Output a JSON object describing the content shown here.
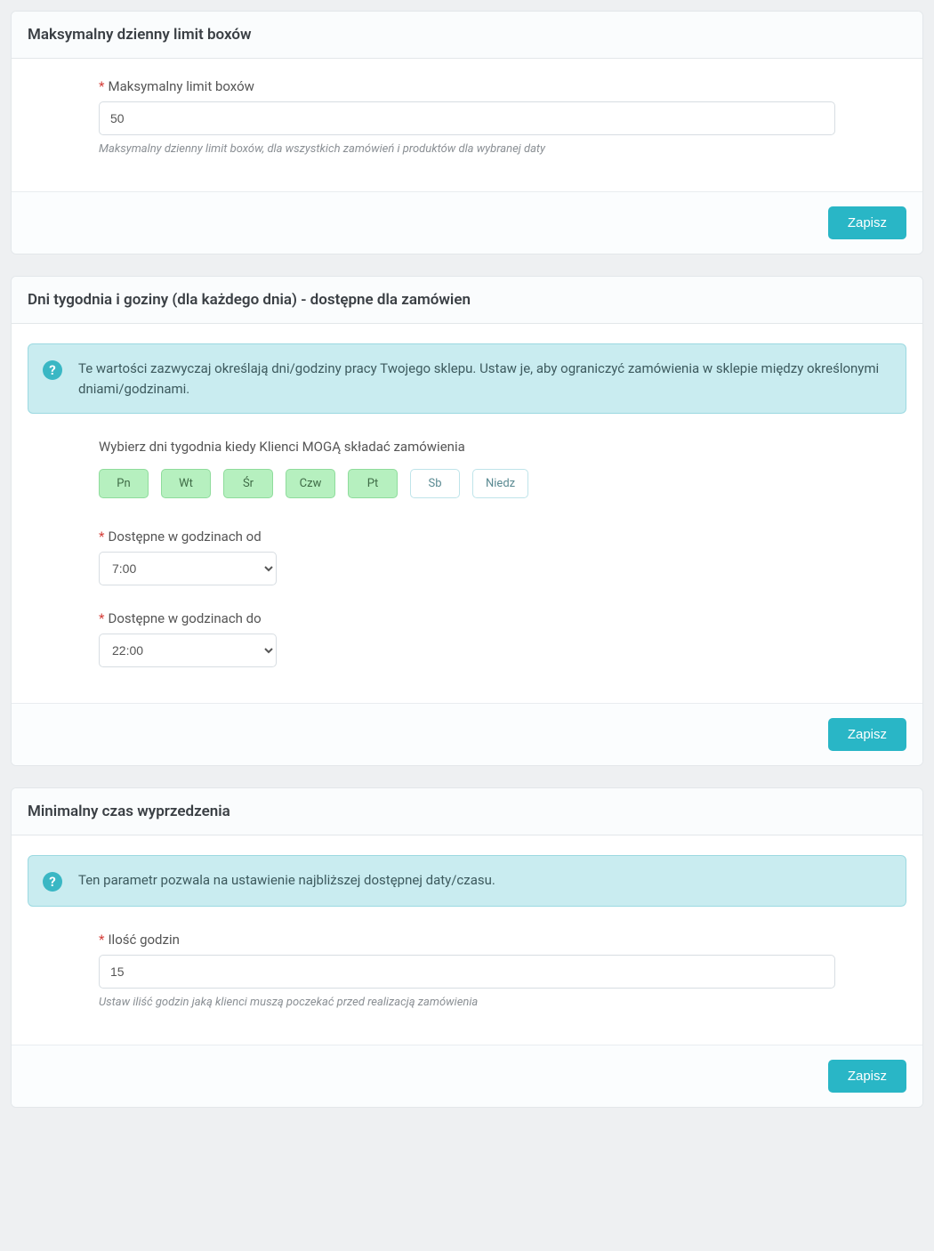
{
  "common": {
    "save_label": "Zapisz"
  },
  "panel1": {
    "title": "Maksymalny dzienny limit boxów",
    "field_label": "Maksymalny limit boxów",
    "field_value": "50",
    "help": "Maksymalny dzienny limit boxów, dla wszystkich zamówień i produktów dla wybranej daty"
  },
  "panel2": {
    "title": "Dni tygodnia i goziny (dla każdego dnia) - dostępne dla zamówien",
    "info": "Te wartości zazwyczaj określają dni/godziny pracy Twojego sklepu. Ustaw je, aby ograniczyć zamówienia w sklepie między określonymi dniami/godzinami.",
    "days_label": "Wybierz dni tygodnia kiedy Klienci MOGĄ składać zamówienia",
    "days": [
      {
        "label": "Pn",
        "selected": true
      },
      {
        "label": "Wt",
        "selected": true
      },
      {
        "label": "Śr",
        "selected": true
      },
      {
        "label": "Czw",
        "selected": true
      },
      {
        "label": "Pt",
        "selected": true
      },
      {
        "label": "Sb",
        "selected": false
      },
      {
        "label": "Niedz",
        "selected": false
      }
    ],
    "from_label": "Dostępne w godzinach od",
    "from_value": "7:00",
    "to_label": "Dostępne w godzinach do",
    "to_value": "22:00"
  },
  "panel3": {
    "title": "Minimalny czas wyprzedzenia",
    "info": "Ten parametr pozwala na ustawienie najbliższej dostępnej daty/czasu.",
    "field_label": "Ilość godzin",
    "field_value": "15",
    "help": "Ustaw iliść godzin jaką klienci muszą poczekać przed realizacją zamówienia"
  }
}
